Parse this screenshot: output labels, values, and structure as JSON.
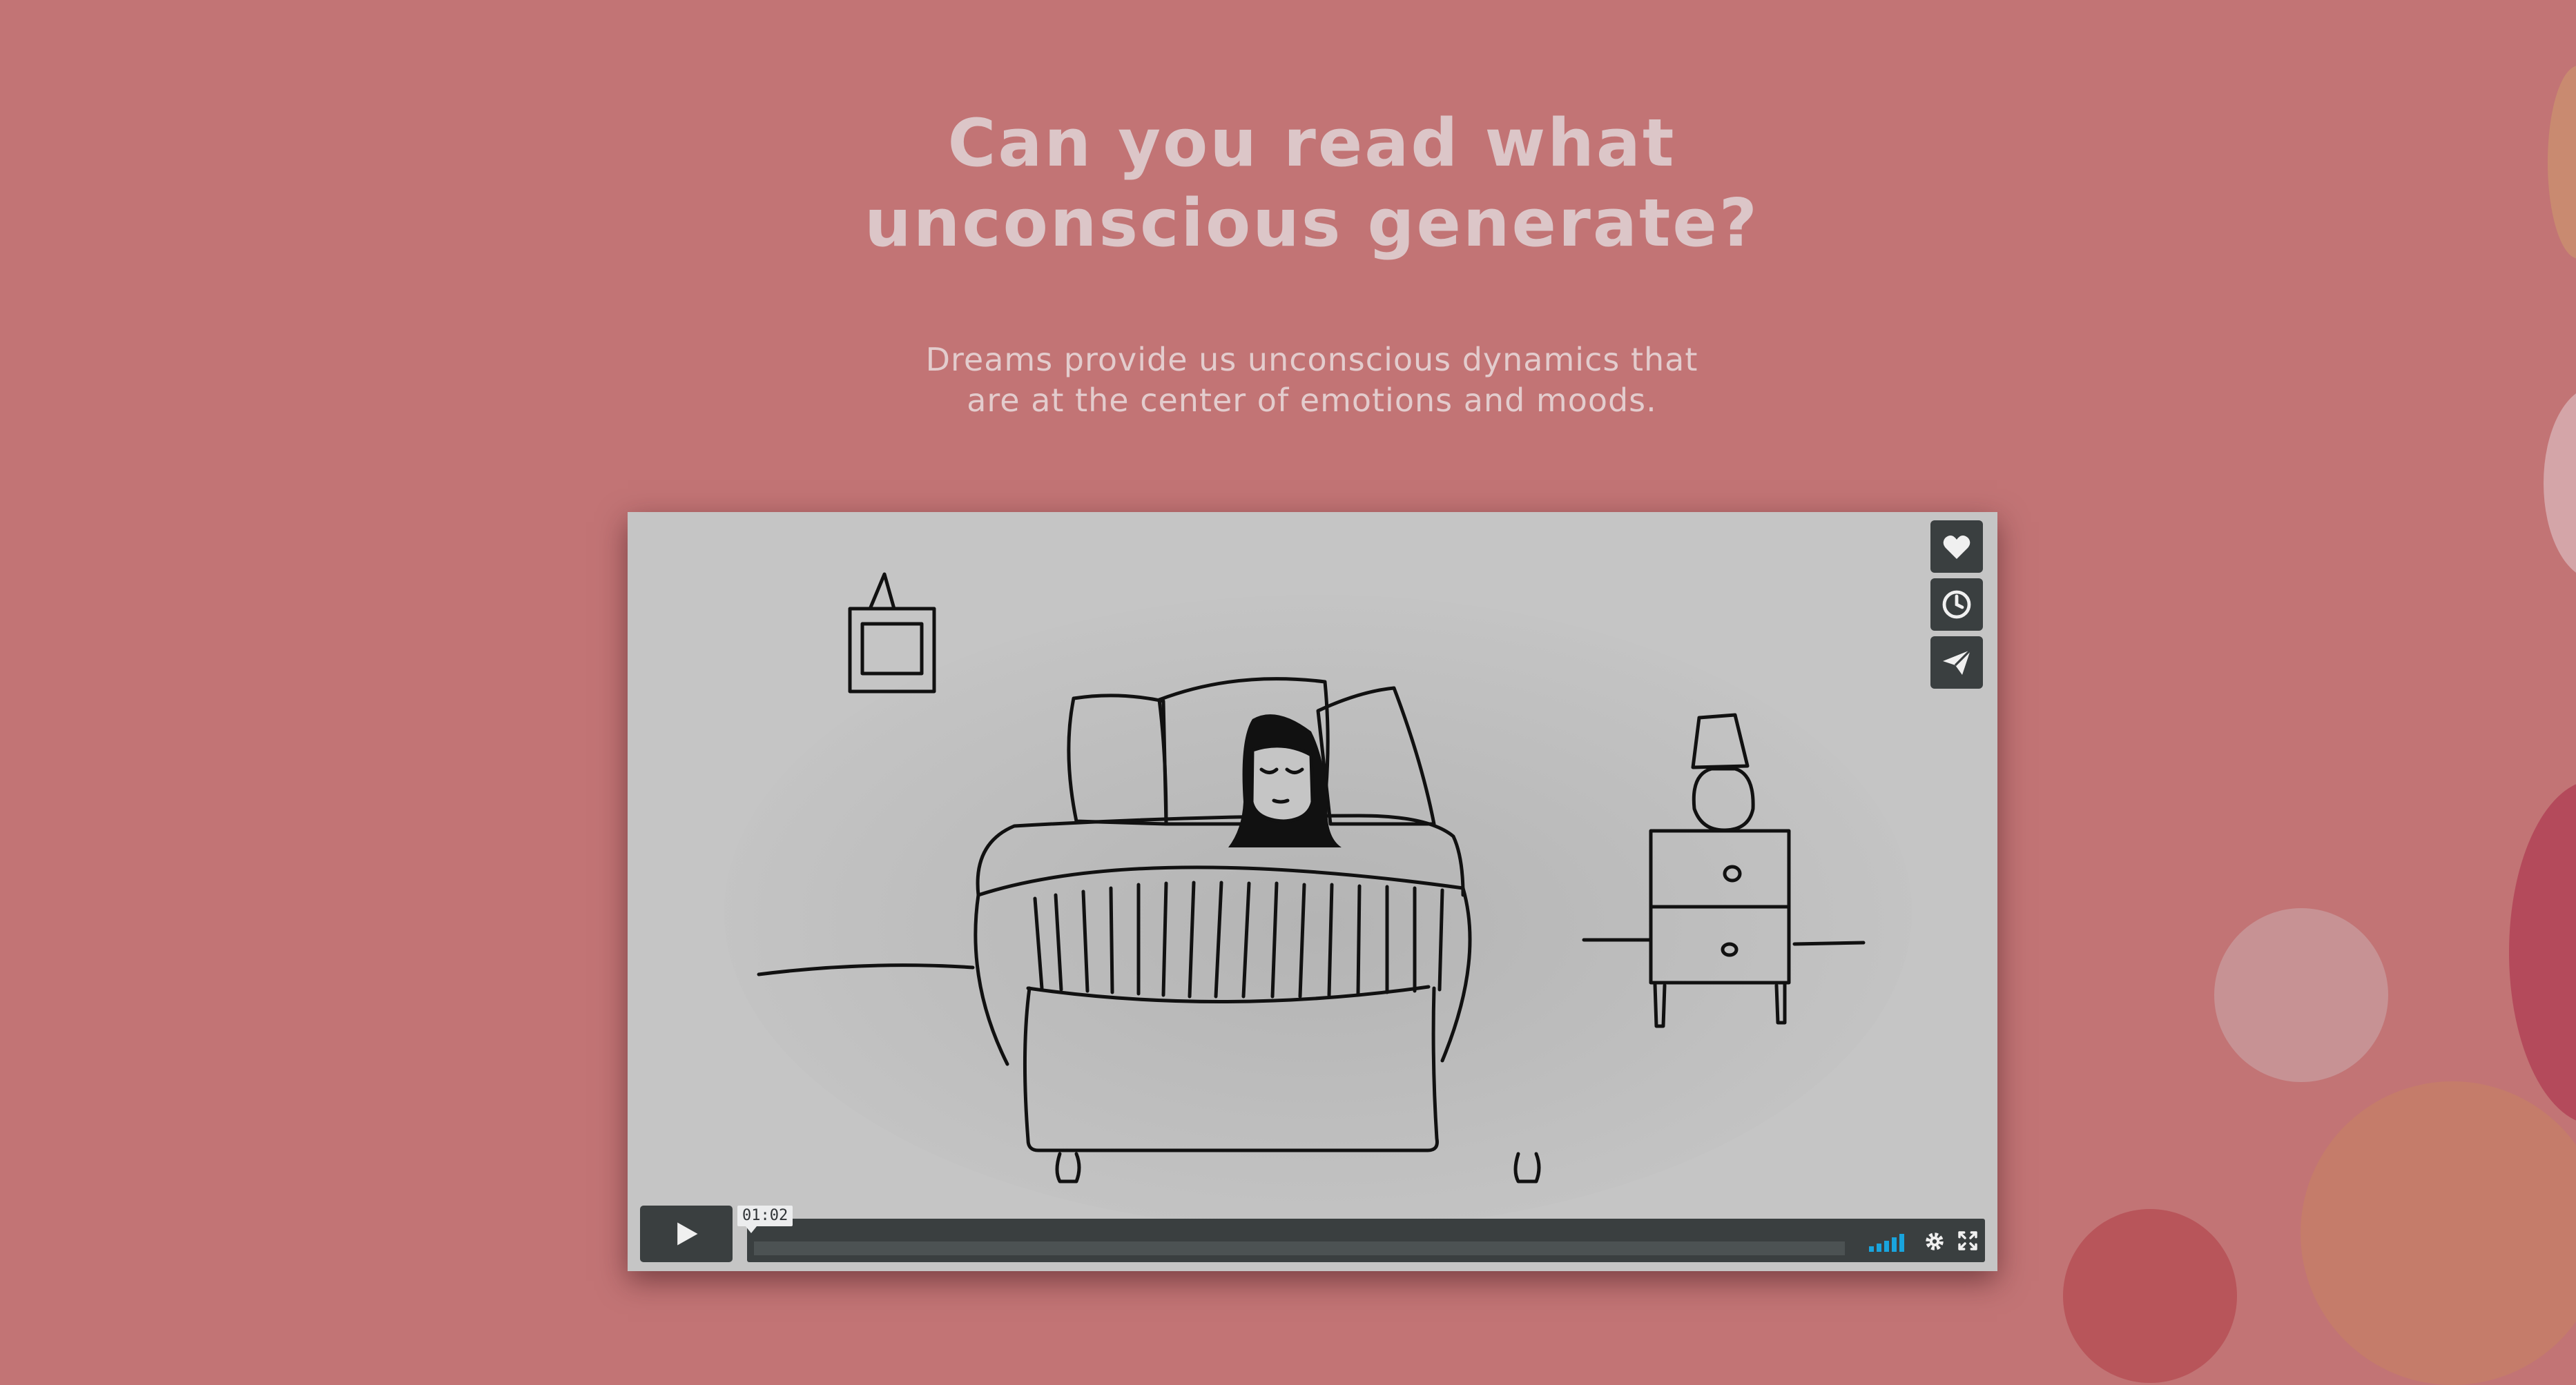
{
  "hero": {
    "title_lines": [
      "Can you read what",
      "unconscious generate?"
    ],
    "subtitle_lines": [
      "Dreams provide us unconscious dynamics that",
      "are at the center of emotions and moods."
    ]
  },
  "video": {
    "current_time": "01:02",
    "progress": 0.0,
    "side_actions": [
      {
        "name": "like",
        "icon": "heart-icon"
      },
      {
        "name": "watch-later",
        "icon": "clock-icon"
      },
      {
        "name": "share",
        "icon": "paper-plane-icon"
      }
    ],
    "controls": {
      "play_icon": "play-icon",
      "volume_icon": "volume-bars-icon",
      "settings_icon": "gear-icon",
      "fullscreen_icon": "fullscreen-icon"
    }
  },
  "colors": {
    "background": "#c27475",
    "title": "#dcc6c8",
    "control": "#3a3f40",
    "volume_accent": "#19a4dd"
  }
}
